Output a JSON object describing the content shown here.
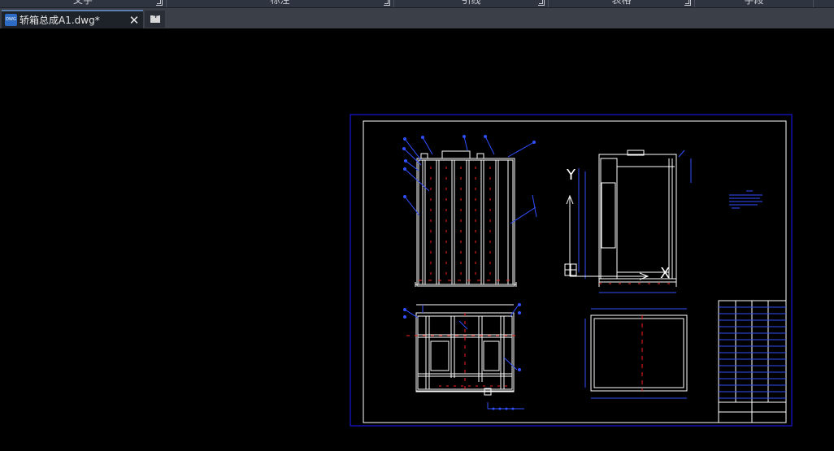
{
  "ribbon": {
    "panels": [
      {
        "label": "文字"
      },
      {
        "label": "标注"
      },
      {
        "label": "引线"
      },
      {
        "label": "表格"
      },
      {
        "label": "字段"
      }
    ]
  },
  "tabs": {
    "file_tab_label": "轿箱总成A1.dwg*",
    "file_icon": "dwg-file-icon",
    "close_icon": "close-icon",
    "new_tab_icon": "new-tab-icon"
  },
  "drawing": {
    "ucs_y_label": "Y",
    "ucs_x_label": "X",
    "colors": {
      "background": "#000000",
      "frame": "#1a1aff",
      "geometry": "#ffffff",
      "centerline": "#ff2020",
      "annotation": "#3050ff"
    }
  }
}
